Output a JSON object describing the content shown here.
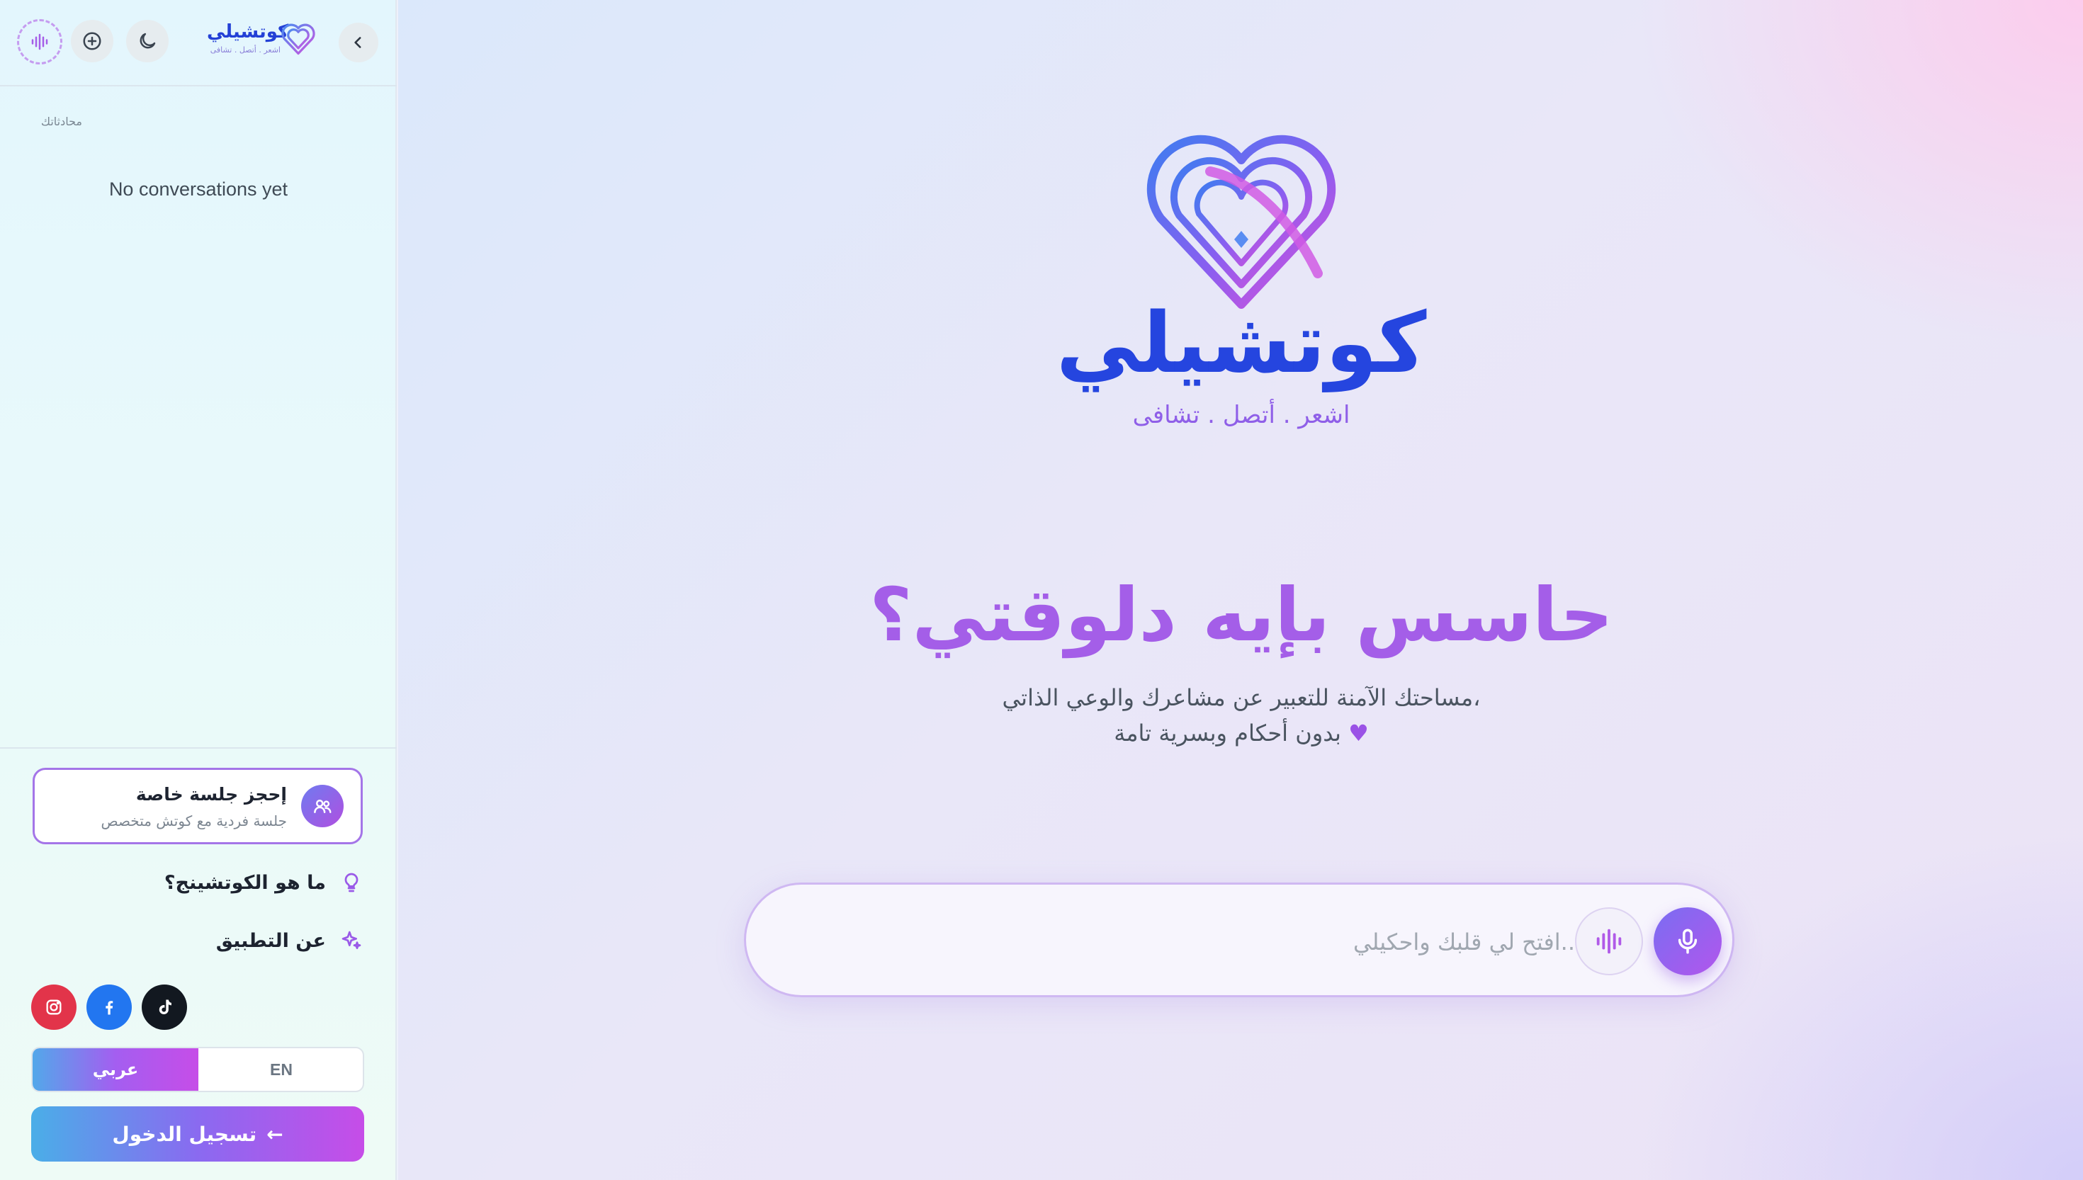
{
  "brand": {
    "name": "كوتشيلي",
    "tagline": "اشعر . أتصل . تشافى"
  },
  "sidebar": {
    "section_title": "محادثاتك",
    "empty_state": "No conversations yet",
    "booking": {
      "title": "إحجز جلسة خاصة",
      "subtitle": "جلسة فردية مع كوتش متخصص"
    },
    "links": [
      {
        "label": "ما هو الكوتشينج؟",
        "icon": "lightbulb-icon"
      },
      {
        "label": "عن التطبيق",
        "icon": "sparkles-icon"
      }
    ],
    "social": [
      "tiktok-icon",
      "facebook-icon",
      "instagram-icon"
    ],
    "language": {
      "en": "EN",
      "ar": "عربي",
      "selected": "ar"
    },
    "login_label": "تسجيل الدخول",
    "login_arrow": "←"
  },
  "main": {
    "title": "حاسس بإيه دلوقتي؟",
    "subtitle_line1": "مساحتك الآمنة للتعبير عن مشاعرك والوعي الذاتي،",
    "subtitle_line2": "بدون أحكام وبسرية تامة",
    "heart": "♥",
    "input_placeholder": "..افتح لي قلبك واحكيلي"
  },
  "colors": {
    "brand_blue": "#2545df",
    "brand_purple": "#a45ee8",
    "accent_pink": "#c64de8"
  }
}
